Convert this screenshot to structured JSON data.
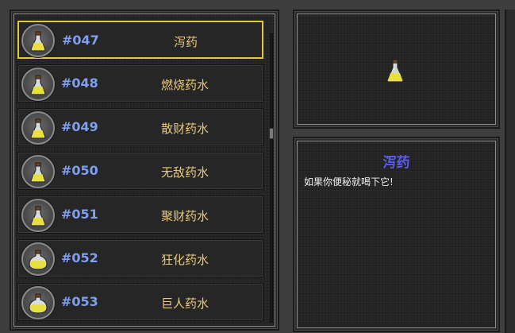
{
  "items": [
    {
      "number": "#047",
      "name": "泻药",
      "size": "small",
      "selected": true
    },
    {
      "number": "#048",
      "name": "燃烧药水",
      "size": "small",
      "selected": false
    },
    {
      "number": "#049",
      "name": "散财药水",
      "size": "small",
      "selected": false
    },
    {
      "number": "#050",
      "name": "无敌药水",
      "size": "small",
      "selected": false
    },
    {
      "number": "#051",
      "name": "聚财药水",
      "size": "small",
      "selected": false
    },
    {
      "number": "#052",
      "name": "狂化药水",
      "size": "large",
      "selected": false
    },
    {
      "number": "#053",
      "name": "巨人药水",
      "size": "large",
      "selected": false
    }
  ],
  "detail": {
    "title": "泻药",
    "description": "如果你便秘就喝下它!"
  },
  "colors": {
    "selected_border": "#e3cc33",
    "number_text": "#7f9ff0",
    "name_text": "#e8c87a",
    "title_text": "#5b5bf0",
    "potion_liquid": "#e8e040"
  },
  "scroll": {
    "position": 0.34
  }
}
